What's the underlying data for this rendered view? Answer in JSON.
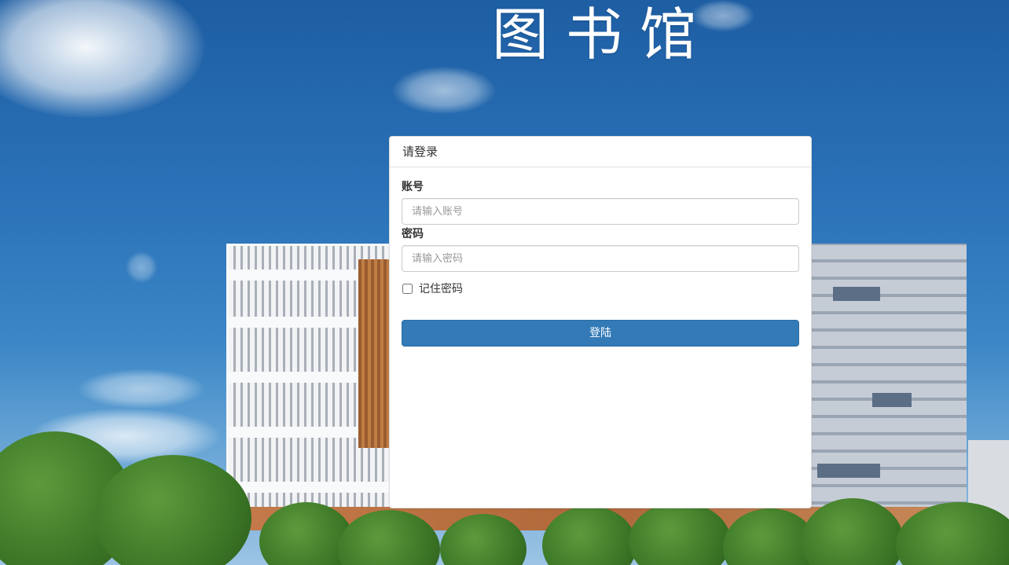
{
  "page": {
    "title": "图书馆"
  },
  "login": {
    "heading": "请登录",
    "account_label": "账号",
    "account_placeholder": "请输入账号",
    "account_value": "",
    "password_label": "密码",
    "password_placeholder": "请输入密码",
    "password_value": "",
    "remember_label": "记住密码",
    "remember_checked": false,
    "submit_label": "登陆"
  },
  "colors": {
    "primary_button": "#337ab7",
    "panel_background": "#ffffff",
    "title_text": "#ffffff"
  }
}
